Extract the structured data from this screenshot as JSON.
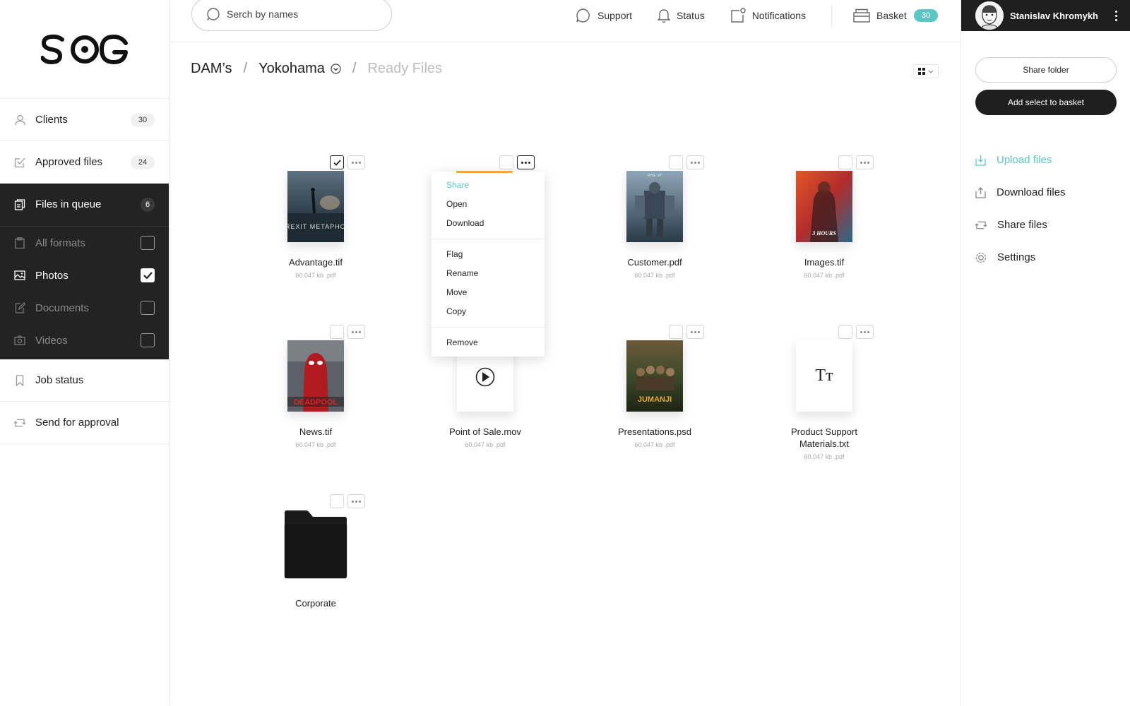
{
  "brand": {
    "logo_text": "SCG",
    "accent": "#5bc6c4",
    "dark": "#232323",
    "progress_color": "#f2a93b"
  },
  "search": {
    "placeholder": "Serch by names"
  },
  "topnav": {
    "support": "Support",
    "status": "Status",
    "notifications": "Notifications",
    "basket": "Basket",
    "basket_count": "30"
  },
  "user": {
    "name": "Stanislav Khromykh"
  },
  "sidebar": {
    "items": [
      {
        "label": "Clients",
        "count": "30",
        "icon": "user-icon"
      },
      {
        "label": "Approved files",
        "count": "24",
        "icon": "check-square-icon"
      },
      {
        "label": "Files in queue",
        "count": "6",
        "icon": "files-icon"
      }
    ],
    "filters": [
      {
        "label": "All formats",
        "icon": "clipboard-icon",
        "checked": false
      },
      {
        "label": "Photos",
        "icon": "image-icon",
        "checked": true
      },
      {
        "label": "Documents",
        "icon": "document-icon",
        "checked": false
      },
      {
        "label": "Videos",
        "icon": "camera-icon",
        "checked": false
      }
    ],
    "bottom": [
      {
        "label": "Job status",
        "icon": "bookmark-icon"
      },
      {
        "label": "Send for approval",
        "icon": "repeat-icon"
      }
    ]
  },
  "breadcrumb": {
    "root": "DAM’s",
    "folder": "Yokohama",
    "current": "Ready Files"
  },
  "files": [
    {
      "name": "Advantage.tif",
      "meta": "60.047 kb .pdf",
      "checked": true
    },
    {
      "name": "",
      "meta": "",
      "checked": false
    },
    {
      "name": "Customer.pdf",
      "meta": "60.047 kb .pdf",
      "checked": false
    },
    {
      "name": "Images.tif",
      "meta": "60.047 kb .pdf",
      "checked": false
    },
    {
      "name": "News.tif",
      "meta": "60.047 kb .pdf",
      "checked": false
    },
    {
      "name": "Point of Sale.mov",
      "meta": "60.047 kb .pdf",
      "checked": false
    },
    {
      "name": "Presentations.psd",
      "meta": "60.047 kb .pdf",
      "checked": false
    },
    {
      "name": "Product Support Materials.txt",
      "meta": "60.047 kb .pdf",
      "checked": false
    },
    {
      "name": "Corporate",
      "meta": "",
      "checked": false
    }
  ],
  "poster_texts": {
    "advantage": "BREXIT METAPHOR",
    "images": "3 HOURS",
    "news": "DEADPOOL",
    "presentations": "JUMANJI",
    "customer": "RISE UP"
  },
  "text_file_glyph": "Tт",
  "context_menu": {
    "group1": [
      "Share",
      "Open",
      "Download"
    ],
    "group2": [
      "Flag",
      "Rename",
      "Move",
      "Copy"
    ],
    "group3": [
      "Remove"
    ],
    "progress": 1.0
  },
  "right_panel": {
    "share_folder": "Share folder",
    "add_to_basket": "Add select to basket",
    "actions": [
      {
        "label": "Upload files",
        "icon": "upload-icon"
      },
      {
        "label": "Download files",
        "icon": "download-icon"
      },
      {
        "label": "Share files",
        "icon": "share-icon"
      },
      {
        "label": "Settings",
        "icon": "gear-icon"
      }
    ]
  }
}
